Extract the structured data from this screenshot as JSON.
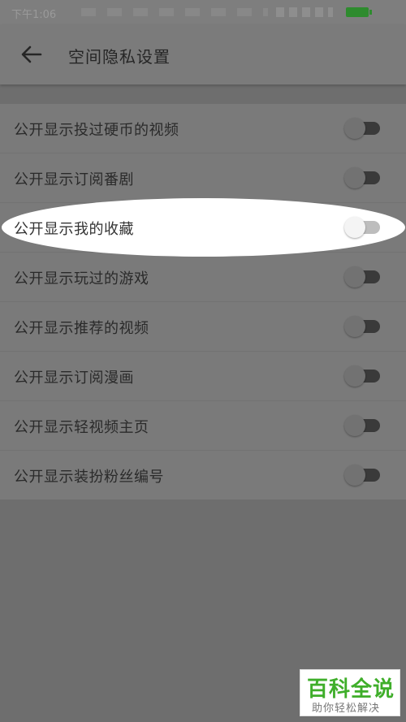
{
  "statusbar": {
    "time": "下午1:06"
  },
  "appbar": {
    "title": "空间隐私设置",
    "back_icon": "arrow-left-icon"
  },
  "settings": [
    {
      "label": "公开显示投过硬币的视频",
      "enabled": false
    },
    {
      "label": "公开显示订阅番剧",
      "enabled": false
    },
    {
      "label": "公开显示我的收藏",
      "enabled": false,
      "highlighted": true
    },
    {
      "label": "公开显示玩过的游戏",
      "enabled": false
    },
    {
      "label": "公开显示推荐的视频",
      "enabled": false
    },
    {
      "label": "公开显示订阅漫画",
      "enabled": false
    },
    {
      "label": "公开显示轻视频主页",
      "enabled": false
    },
    {
      "label": "公开显示装扮粉丝编号",
      "enabled": false
    }
  ],
  "watermark": {
    "title": "百科全说",
    "subtitle": "助你轻松解决"
  },
  "colors": {
    "watermark_green": "#3fae2a",
    "dim_overlay": "#6e6e6e"
  }
}
